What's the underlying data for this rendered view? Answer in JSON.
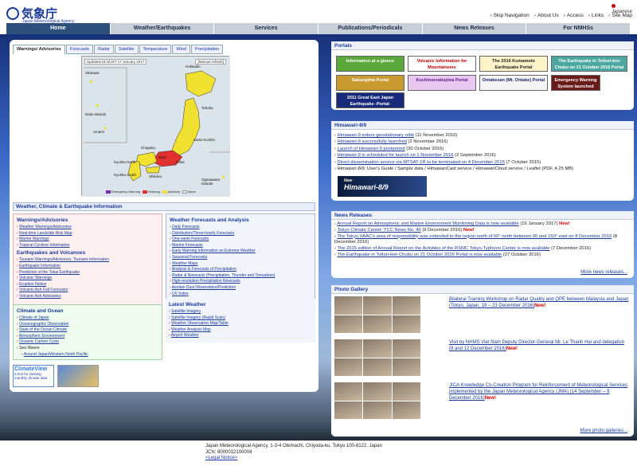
{
  "header": {
    "logo_jp": "気象庁",
    "logo_en": "Japan Meteorological Agency",
    "language": "Japanese",
    "links": [
      "Skip Navigation",
      "About Us",
      "Access",
      "Links",
      "Site Map"
    ]
  },
  "nav": [
    "Home",
    "Weather/Earthquakes",
    "Services",
    "Publications/Periodicals",
    "News Releases",
    "For NMHSs"
  ],
  "tabs": [
    "Warnings/ Advisories",
    "Forecasts",
    "Radar",
    "Satellite",
    "Temperature",
    "Wind",
    "Precipitation"
  ],
  "map": {
    "title": "Updated:16:34JST 17 January 2017",
    "update_button": "[Manual refresh]",
    "legend": [
      {
        "label": "Emergency Warning",
        "color": "#7a2aa8"
      },
      {
        "label": "Warning",
        "color": "#e03030"
      },
      {
        "label": "Advisory",
        "color": "#f0e030"
      },
      {
        "label": "None",
        "color": "#f0f0f0"
      }
    ],
    "labels": [
      "Hokkaido",
      "Okinawa",
      "Tohoku",
      "Kanto-Koshin",
      "Tokai",
      "Kinki",
      "Chugoku",
      "Shikoku",
      "Kyushu North",
      "Kyushu South",
      "Amami",
      "Daito Islands",
      "Ogasawara Islands"
    ]
  },
  "weather_section_title": "Weather, Climate & Earthquake Information",
  "warnings": {
    "title": "Warnings/Advisories",
    "items": [
      "Weather Warnings/Advisories",
      "Real-time Landslide Risk Map",
      "Marine Warnings",
      "Tropical Cyclone Information"
    ]
  },
  "earthquakes": {
    "title": "Earthquakes and Volcanoes",
    "items": [
      "Tsunami Warnings/Advisories, Tsunami Information",
      "Earthquake Information",
      "Prediction of the Tokai Earthquake",
      "Volcanic Warnings",
      "Eruption Notice",
      "Volcanic Ash Fall Forecasts",
      "Volcanic Ash Advisories"
    ]
  },
  "climate": {
    "title": "Climate and Ocean",
    "items": [
      "Climate of Japan",
      "Oceanographic Observation",
      "State of the Ocean Climate",
      "Atmospheric Environment",
      "Oceanic Carbon Cycle",
      "Sea Waves",
      "Around Japan/Western North Pacific"
    ]
  },
  "forecasts": {
    "title": "Weather Forecasts and Analysis",
    "items": [
      "Daily Forecasts",
      "Distribution/Three-hourly Forecasts",
      "One-week Forecasts",
      "Marine Forecasts",
      "Early Warning Information on Extreme Weather",
      "Seasonal Forecasts",
      "Weather Maps",
      "Analysis & Forecasts of Precipitation",
      "Radar & Nowcasts (Precipitation, Thunder and Tornadoes)",
      "High-resolution Precipitation Nowcasts",
      "Aeolian Dust Observation/Prediction",
      "UV Index"
    ]
  },
  "latest": {
    "title": "Latest Weather",
    "items": [
      "Satellite Imagery",
      "Satellite Imagery (Rapid Scan)",
      "Weather Observation Map/Table",
      "Weather Analysis Map",
      "Airport Weather"
    ]
  },
  "banners": {
    "climateview_title": "ClimateView",
    "climateview_sub": "a tool for viewing monthly climate data"
  },
  "portals": {
    "title": "Portals",
    "items": [
      {
        "label": "Information at a glance",
        "bg": "#5aa83a",
        "fg": "#ffffff"
      },
      {
        "label": "Volcanic Information for Mountaineers",
        "bg": "#ffffff",
        "fg": "#c00000"
      },
      {
        "label": "The 2016 Kumamoto Earthquake Portal",
        "bg": "#fdf3c8",
        "fg": "#222222"
      },
      {
        "label": "The Earthquake in Tottori-ken Chubu on 21 October 2016 Portal",
        "bg": "#4aa8a0",
        "fg": "#ffffff"
      },
      {
        "label": "Sakurajima Portal",
        "bg": "#c89a30",
        "fg": "#ffffff"
      },
      {
        "label": "Kuchinoerabujima Portal",
        "bg": "#e8c8f0",
        "fg": "#5a1a8a"
      },
      {
        "label": "Ontakesan (Mt. Ontake) Portal",
        "bg": "#f4f4f4",
        "fg": "#1a2a6a"
      },
      {
        "label": "Emergency Warning System launched",
        "bg": "#6a1a1a",
        "fg": "#ffffff"
      },
      {
        "label": "2011 Great East Japan Earthquake -Portal-",
        "bg": "#1a2a7a",
        "fg": "#ffffff"
      }
    ]
  },
  "himawari": {
    "title": "Himawari-8/9",
    "items": [
      {
        "link": "Himawari-9 enters geostationary orbit",
        "date": "(11 November 2016)"
      },
      {
        "link": "Himawari-9 successfully launched",
        "date": "(2 November 2016)"
      },
      {
        "link": "Launch of Himawari-9 postponed",
        "date": "(30 October 2016)"
      },
      {
        "link": "Himawari-9 is scheduled for launch on 1 November 2016",
        "date": "(2 September 2016)"
      },
      {
        "link": "Direct dissemination service via MTSAT-1R to be terminated on 4 December 2015",
        "date": "(7 October 2015)"
      }
    ],
    "last_line": "Himawari-8/9: User's Guide / Sample data / HimawariCast service / HimawariCloud service / Leaflet (PDF, 4.25 MB)",
    "banner_new": "New",
    "banner_title": "Himawari-8/9"
  },
  "news": {
    "title": "News Releases",
    "items": [
      {
        "link": "Annual Report on Atmospheric and Marine Environment Monitoring Data is now available",
        "date": "(16 January 2017)",
        "new": "New!"
      },
      {
        "link": "Tokyo Climate Center: TCC News No. 46",
        "date": "(9 December 2016)",
        "new": "New!"
      },
      {
        "link": "The Tokyo VAAC's area of responsibility was extended to the region north of 60° north between 90 and 150° east on 8 December 2016",
        "date": "(8 December 2016)",
        "new": ""
      },
      {
        "link": "The 2015 edition of Annual Report on the Activities of the RSMC Tokyo-Typhoon Center is now available",
        "date": "(7 December 2016)",
        "new": ""
      },
      {
        "link": "The Earthquake in Tottori-ken Chubu on 21 October 2016 Portal is now available",
        "date": "(27 October 2016)",
        "new": ""
      }
    ],
    "more": "More news releases..."
  },
  "gallery": {
    "title": "Photo Gallery",
    "items": [
      {
        "text": "Bilateral Training Workshop on Radar Quality and QPE between Malaysia and Japan (Tokyo, Japan, 19 – 23 December 2016)",
        "new": "New!"
      },
      {
        "text": "Visit by NHMS Viet Nam Deputy Director-General Mr. Le Thanh Hai and delegation (8 and 12 December 2016)",
        "new": "New!"
      },
      {
        "text": "JICA Knowledge Co-Creation Program for Reinforcement of Meteorological Services implemented by the Japan Meteorological Agency (JMA) (14 September – 9 December 2016)",
        "new": "New!"
      }
    ],
    "more": "More photo galleries..."
  },
  "footer": {
    "address": "Japan Meteorological Agency, 1-3-4 Otemachi, Chiyoda-ku, Tokyo 100-8122, Japan",
    "jcn": "JCN: 8000012100004",
    "legal": "<Legal Notice>"
  }
}
